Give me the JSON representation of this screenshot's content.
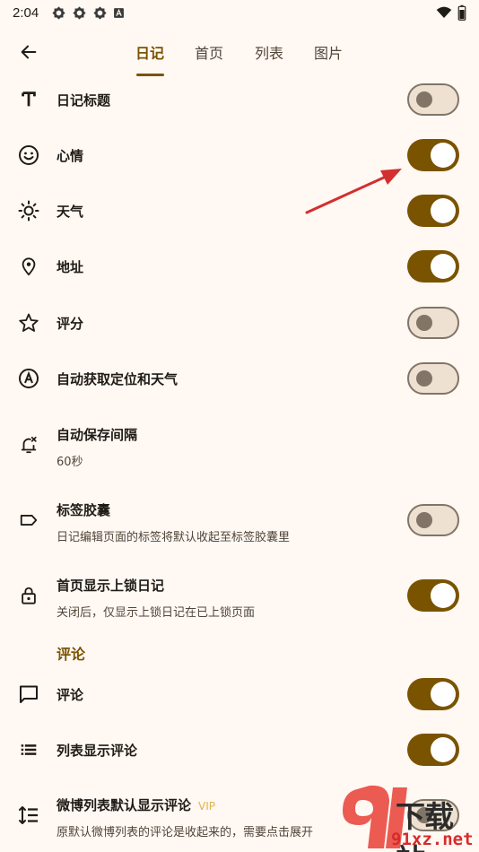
{
  "status_bar": {
    "time": "2:04",
    "notif_icons": [
      "gear-icon",
      "gear-icon",
      "gear-icon",
      "a-badge-icon"
    ],
    "right_icons": [
      "wifi-icon",
      "battery-icon"
    ]
  },
  "tabs": [
    {
      "label": "日记",
      "active": true
    },
    {
      "label": "首页",
      "active": false
    },
    {
      "label": "列表",
      "active": false
    },
    {
      "label": "图片",
      "active": false
    }
  ],
  "settings": [
    {
      "id": "diary-title",
      "title": "日记标题",
      "sub": "",
      "icon": "text-icon",
      "on": false
    },
    {
      "id": "mood",
      "title": "心情",
      "sub": "",
      "icon": "smiley-icon",
      "on": true
    },
    {
      "id": "weather",
      "title": "天气",
      "sub": "",
      "icon": "sun-icon",
      "on": true
    },
    {
      "id": "address",
      "title": "地址",
      "sub": "",
      "icon": "location-pin-icon",
      "on": true
    },
    {
      "id": "rating",
      "title": "评分",
      "sub": "",
      "icon": "star-icon",
      "on": false
    },
    {
      "id": "auto-location",
      "title": "自动获取定位和天气",
      "sub": "",
      "icon": "auto-a-icon",
      "on": false
    },
    {
      "id": "autosave",
      "title": "自动保存间隔",
      "sub": "60秒",
      "icon": "alarm-icon"
    },
    {
      "id": "tag-capsule",
      "title": "标签胶囊",
      "sub": "日记编辑页面的标签将默认收起至标签胶囊里",
      "icon": "label-icon",
      "on": false
    },
    {
      "id": "show-locked",
      "title": "首页显示上锁日记",
      "sub": "关闭后，仅显示上锁日记在已上锁页面",
      "icon": "lock-icon",
      "on": true
    }
  ],
  "comments_section": {
    "header": "评论",
    "items": [
      {
        "id": "comments",
        "title": "评论",
        "sub": "",
        "icon": "comment-icon",
        "on": true
      },
      {
        "id": "list-comments",
        "title": "列表显示评论",
        "sub": "",
        "icon": "list-icon",
        "on": true
      },
      {
        "id": "weibo-comments",
        "title": "微博列表默认显示评论",
        "vip": "VIP",
        "sub": "原默认微博列表的评论是收起来的，需要点击展开",
        "icon": "line-spacing-icon",
        "on": false
      }
    ]
  },
  "watermark": {
    "brand": "下载站",
    "domain": "91xz.net"
  },
  "colors": {
    "accent": "#7A5300",
    "background": "#FFF8F3",
    "switch_off_track": "#EEE1D1",
    "outline": "#817567",
    "vip": "#E0B34E",
    "annotation_arrow": "#D32F2F"
  }
}
